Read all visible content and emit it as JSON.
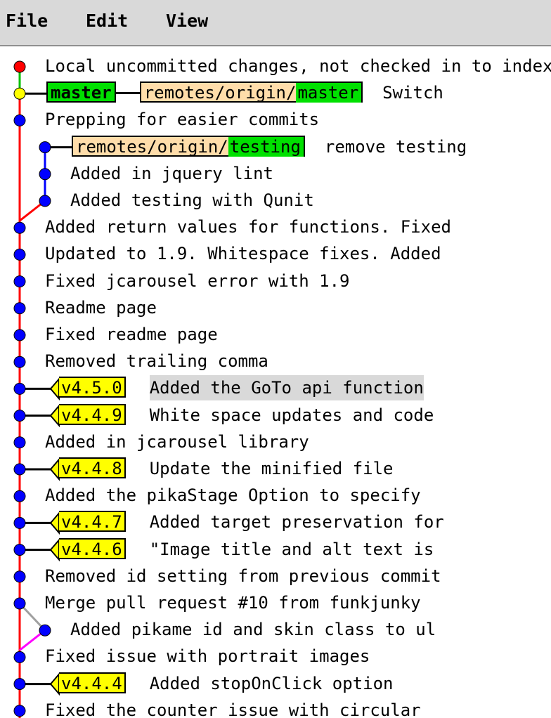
{
  "menu": {
    "file": "File",
    "edit": "Edit",
    "view": "View"
  },
  "colors": {
    "local_changes_dot": "#ff0000",
    "head_dot": "#ffff00",
    "commit_dot": "#0000ff",
    "main_line": "#ff0000",
    "branch_line": "#0000ff",
    "merge_line": "#ff00ff",
    "local_line": "#00c000",
    "head_ref_bg": "#00e000",
    "remote_ref_bg": "#ffddaa",
    "tag_bg": "#ffff00",
    "selected_row_bg": "#d9d9d9"
  },
  "commits": [
    {
      "message": "Local uncommitted changes, not checked in to index"
    },
    {
      "head_ref": "master",
      "remote_prefix": "remotes/origin/",
      "remote_branch": "master",
      "message": "Switch"
    },
    {
      "message": "Prepping for easier commits"
    },
    {
      "remote_prefix": "remotes/origin/",
      "remote_branch": "testing",
      "message": "remove testing"
    },
    {
      "message": "Added in jquery lint"
    },
    {
      "message": "Added testing with Qunit"
    },
    {
      "message": "Added return values for functions. Fixed"
    },
    {
      "message": "Updated to 1.9. Whitespace fixes. Added"
    },
    {
      "message": "Fixed jcarousel error with 1.9"
    },
    {
      "message": "Readme page"
    },
    {
      "message": "Fixed readme page"
    },
    {
      "message": "Removed trailing comma"
    },
    {
      "tag": "v4.5.0",
      "message": "Added the GoTo api function",
      "selected": true
    },
    {
      "tag": "v4.4.9",
      "message": "White space updates and code"
    },
    {
      "message": "Added in jcarousel library"
    },
    {
      "tag": "v4.4.8",
      "message": "Update the minified file"
    },
    {
      "message": "Added the pikaStage Option to specify"
    },
    {
      "tag": "v4.4.7",
      "message": "Added target preservation for"
    },
    {
      "tag": "v4.4.6",
      "message": "\"Image title and alt text is"
    },
    {
      "message": "Removed id setting from previous commit"
    },
    {
      "message": "Merge pull request #10 from funkjunky"
    },
    {
      "message": "Added pikame id and skin class to ul"
    },
    {
      "message": "Fixed issue with portrait images"
    },
    {
      "tag": "v4.4.4",
      "message": "Added stopOnClick option"
    },
    {
      "message": "Fixed the counter issue with circular"
    }
  ]
}
